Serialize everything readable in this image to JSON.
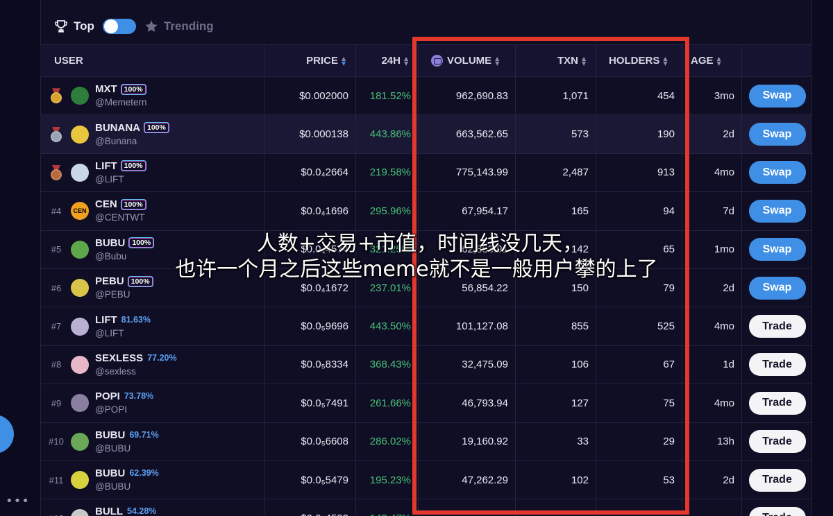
{
  "filter": {
    "top_label": "Top",
    "trending_label": "Trending"
  },
  "table": {
    "headers": {
      "user": "USER",
      "price": "PRICE",
      "change": "24H",
      "volume": "VOLUME",
      "txn": "TXN",
      "holders": "HOLDERS",
      "age": "AGE"
    },
    "rows": [
      {
        "rank": "",
        "medal": "gold-medal-icon",
        "name": "MXT",
        "badge": "100%",
        "handle": "@Memetern",
        "price": "$0.002000",
        "change": "181.52%",
        "volume": "962,690.83",
        "txn": "1,071",
        "holders": "454",
        "age": "3mo",
        "action": "Swap",
        "avatar_color": "#2f7d3b"
      },
      {
        "rank": "",
        "medal": "silver-medal-icon",
        "name": "BUNANA",
        "badge": "100%",
        "handle": "@Bunana",
        "price": "$0.000138",
        "change": "443.86%",
        "volume": "663,562.65",
        "txn": "573",
        "holders": "190",
        "age": "2d",
        "action": "Swap",
        "avatar_color": "#e8c63d"
      },
      {
        "rank": "",
        "medal": "bronze-medal-icon",
        "name": "LIFT",
        "badge": "100%",
        "handle": "@LIFT",
        "price": "$0.0₄2664",
        "change": "219.58%",
        "volume": "775,143.99",
        "txn": "2,487",
        "holders": "913",
        "age": "4mo",
        "action": "Swap",
        "avatar_color": "#c9d6e8"
      },
      {
        "rank": "#4",
        "medal": "",
        "name": "CEN",
        "badge": "100%",
        "handle": "@CENTWT",
        "price": "$0.0₄1696",
        "change": "295.96%",
        "volume": "67,954.17",
        "txn": "165",
        "holders": "94",
        "age": "7d",
        "action": "Swap",
        "avatar_color": "#f0a020",
        "avatar_text": "CEN"
      },
      {
        "rank": "#5",
        "medal": "",
        "name": "BUBU",
        "badge": "100%",
        "handle": "@Bubu",
        "price": "$0.0₄4574",
        "change": "321.25%",
        "volume": "62,853.91",
        "txn": "142",
        "holders": "65",
        "age": "1mo",
        "action": "Swap",
        "avatar_color": "#5fa84a"
      },
      {
        "rank": "#6",
        "medal": "",
        "name": "PEBU",
        "badge": "100%",
        "handle": "@PEBU",
        "price": "$0.0₄1672",
        "change": "237.01%",
        "volume": "56,854.22",
        "txn": "150",
        "holders": "79",
        "age": "2d",
        "action": "Swap",
        "avatar_color": "#d8c44a"
      },
      {
        "rank": "#7",
        "medal": "",
        "name": "LIFT",
        "badge": "81.63%",
        "handle": "@LIFT",
        "price": "$0.0₅9696",
        "change": "443.50%",
        "volume": "101,127.08",
        "txn": "855",
        "holders": "525",
        "age": "4mo",
        "action": "Trade",
        "avatar_color": "#b9b0d4"
      },
      {
        "rank": "#8",
        "medal": "",
        "name": "SEXLESS",
        "badge": "77.20%",
        "handle": "@sexless",
        "price": "$0.0₅8334",
        "change": "368.43%",
        "volume": "32,475.09",
        "txn": "106",
        "holders": "67",
        "age": "1d",
        "action": "Trade",
        "avatar_color": "#e9b8c8"
      },
      {
        "rank": "#9",
        "medal": "",
        "name": "POPI",
        "badge": "73.78%",
        "handle": "@POPI",
        "price": "$0.0₅7491",
        "change": "261.66%",
        "volume": "46,793.94",
        "txn": "127",
        "holders": "75",
        "age": "4mo",
        "action": "Trade",
        "avatar_color": "#8a7fa0"
      },
      {
        "rank": "#10",
        "medal": "",
        "name": "BUBU",
        "badge": "69.71%",
        "handle": "@BUBU",
        "price": "$0.0₅6608",
        "change": "286.02%",
        "volume": "19,160.92",
        "txn": "33",
        "holders": "29",
        "age": "13h",
        "action": "Trade",
        "avatar_color": "#6aa857"
      },
      {
        "rank": "#11",
        "medal": "",
        "name": "BUBU",
        "badge": "62.39%",
        "handle": "@BUBU",
        "price": "$0.0₅5479",
        "change": "195.23%",
        "volume": "47,262.29",
        "txn": "102",
        "holders": "53",
        "age": "2d",
        "action": "Trade",
        "avatar_color": "#d9d23f"
      },
      {
        "rank": "#12",
        "medal": "",
        "name": "BULL",
        "badge": "54.28%",
        "handle": "@BULL",
        "price": "$0.0₅4523",
        "change": "143.47%",
        "volume": "",
        "txn": "",
        "holders": "",
        "age": "",
        "action": "Trade",
        "avatar_color": "#c9c9c9"
      }
    ]
  },
  "overlay_caption": {
    "line1": "人数+交易+市值，时间线没几天，",
    "line2": "也许一个月之后这些meme就不是一般用户攀的上了"
  },
  "colors": {
    "accent": "#3f8fe6",
    "positive": "#46c077",
    "highlight_box": "#e3382b"
  }
}
